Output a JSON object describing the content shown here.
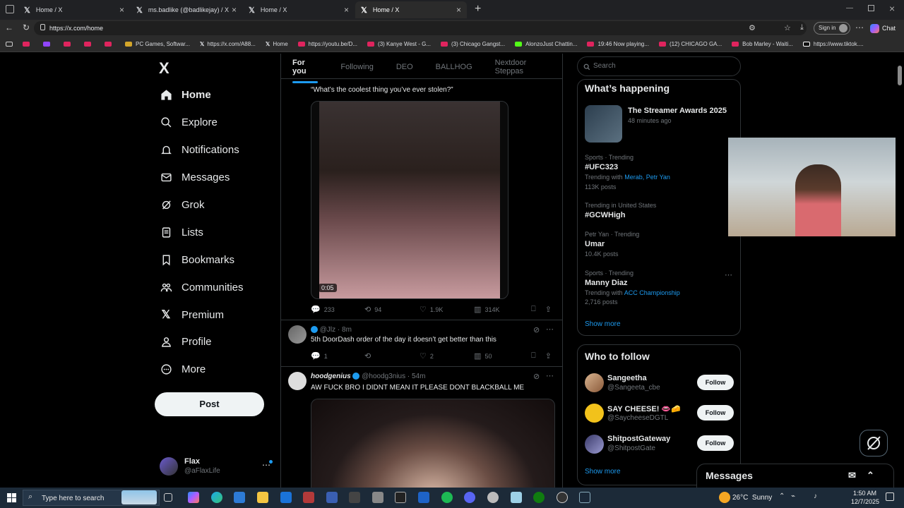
{
  "browser": {
    "tabs": [
      {
        "title": "Home / X",
        "active": false
      },
      {
        "title": "ms.badlike (@badlikejay) / X",
        "active": false
      },
      {
        "title": "Home / X",
        "active": false
      },
      {
        "title": "Home / X",
        "active": true
      }
    ],
    "url": "https://x.com/home",
    "signin_label": "Sign in",
    "chat_label": "Chat",
    "bookmarks": [
      "PC Games, Softwar...",
      "https://x.com/A88...",
      "Home",
      "https://youtu.be/D...",
      "(3) Kanye West - G...",
      "(3) Chicago Gangst...",
      "AlonzoJust Chattin...",
      "19:46 Now playing...",
      "(12) CHICAGO GA...",
      "Bob Marley - Waiti...",
      "https://www.tiktok...."
    ]
  },
  "x": {
    "logo": "X",
    "nav": [
      {
        "label": "Home",
        "icon": "home-icon"
      },
      {
        "label": "Explore",
        "icon": "search-icon"
      },
      {
        "label": "Notifications",
        "icon": "bell-icon"
      },
      {
        "label": "Messages",
        "icon": "envelope-icon"
      },
      {
        "label": "Grok",
        "icon": "grok-icon"
      },
      {
        "label": "Lists",
        "icon": "list-icon"
      },
      {
        "label": "Bookmarks",
        "icon": "bookmark-icon"
      },
      {
        "label": "Communities",
        "icon": "people-icon"
      },
      {
        "label": "Premium",
        "icon": "x-icon"
      },
      {
        "label": "Profile",
        "icon": "person-icon"
      },
      {
        "label": "More",
        "icon": "more-circle-icon"
      }
    ],
    "post_label": "Post",
    "account": {
      "name": "Flax",
      "handle": "@aFlaxLife"
    },
    "tabs": [
      "For you",
      "Following",
      "DEO",
      "BALLHOG",
      "Nextdoor Steppas"
    ],
    "feed": {
      "tweet1": {
        "quote": "“What’s the coolest thing you’ve ever stolen?”",
        "video_time": "0:05",
        "replies": "233",
        "reposts": "94",
        "likes": "1.9K",
        "views": "314K"
      },
      "tweet2": {
        "handle": "@Jlz",
        "time": "8m",
        "text": "5th DoorDash order of the day it doesn’t get better than this",
        "replies": "1",
        "likes": "2",
        "views": "50"
      },
      "tweet3": {
        "name": "hoodgenius",
        "handle": "@hoodg3nius",
        "time": "54m",
        "text": "AW FUCK BRO I DIDNT MEAN IT PLEASE DONT BLACKBALL ME"
      }
    },
    "search_placeholder": "Search",
    "happening": {
      "title": "What’s happening",
      "featured": {
        "title": "The Streamer Awards 2025",
        "time": "48 minutes ago"
      },
      "trends": [
        {
          "context": "Sports · Trending",
          "name": "#UFC323",
          "with_label": "Trending with",
          "with": "Merab, Petr Yan",
          "posts": "113K posts"
        },
        {
          "context": "Trending in United States",
          "name": "#GCWHigh",
          "with_label": "",
          "with": "",
          "posts": ""
        },
        {
          "context": "Petr Yan · Trending",
          "name": "Umar",
          "with_label": "",
          "with": "",
          "posts": "10.4K posts"
        },
        {
          "context": "Sports · Trending",
          "name": "Manny Diaz",
          "with_label": "Trending with",
          "with": "ACC Championship",
          "posts": "2,716 posts"
        }
      ],
      "show_more": "Show more"
    },
    "who_to_follow": {
      "title": "Who to follow",
      "users": [
        {
          "name": "Sangeetha",
          "handle": "@Sangeeta_cbe"
        },
        {
          "name": "SAY CHEESE! 👄🧀",
          "handle": "@SaycheeseDGTL"
        },
        {
          "name": "ShitpostGateway",
          "handle": "@ShitpostGate"
        }
      ],
      "follow_label": "Follow",
      "show_more": "Show more"
    },
    "messages_label": "Messages"
  },
  "taskbar": {
    "search_placeholder": "Type here to search",
    "weather": "26°C  Sunny",
    "time": "1:50 AM",
    "date": "12/7/2025"
  },
  "colors": {
    "accent": "#1d9bf0",
    "bg": "#000000",
    "border": "#2f3336",
    "muted": "#71767b"
  }
}
